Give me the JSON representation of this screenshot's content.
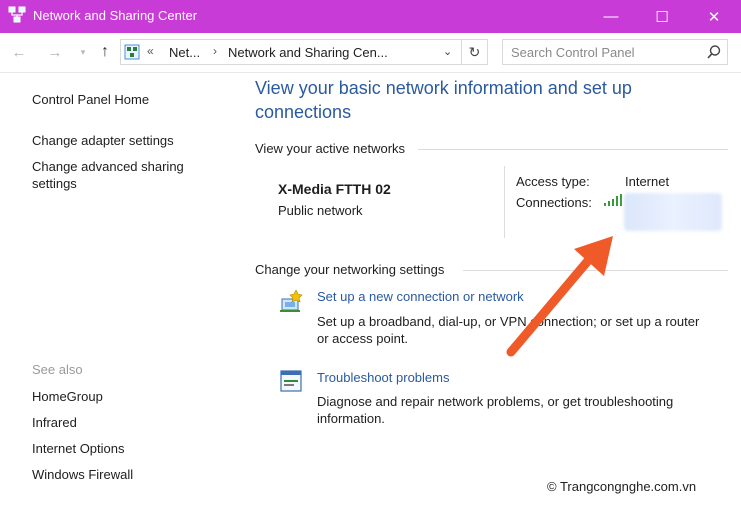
{
  "window": {
    "title": "Network and Sharing Center",
    "controls": {
      "minimize": "—",
      "maximize": "☐",
      "close": "✕"
    }
  },
  "address_bar": {
    "overflow": "«",
    "crumbs": [
      "Net...",
      "Network and Sharing Cen..."
    ],
    "search_placeholder": "Search Control Panel"
  },
  "left_pane": {
    "links": [
      "Control Panel Home",
      "Change adapter settings",
      "Change advanced sharing settings"
    ],
    "see_also_label": "See also",
    "see_also": [
      "HomeGroup",
      "Infrared",
      "Internet Options",
      "Windows Firewall"
    ]
  },
  "main": {
    "title": "View your basic network information and set up connections",
    "active_networks_label": "View your active networks",
    "network": {
      "name": "X-Media FTTH 02",
      "type": "Public network",
      "access_type_label": "Access type:",
      "access_type_value": "Internet",
      "connections_label": "Connections:"
    },
    "change_settings_label": "Change your networking settings",
    "tasks": [
      {
        "title": "Set up a new connection or network",
        "desc": "Set up a broadband, dial-up, or VPN connection; or set up a router or access point."
      },
      {
        "title": "Troubleshoot problems",
        "desc": "Diagnose and repair network problems, or get troubleshooting information."
      }
    ]
  },
  "annotation": {
    "arrow_color": "#f05a28"
  },
  "watermark": "© Trangcongnghe.com.vn",
  "colors": {
    "titlebar": "#c93bd6",
    "link": "#2a5aa0"
  },
  "icons": [
    "network-app-icon",
    "back-arrow-icon",
    "forward-arrow-icon",
    "up-arrow-icon",
    "location-icon",
    "refresh-icon",
    "search-icon",
    "signal-bars-icon",
    "new-connection-icon",
    "troubleshoot-icon"
  ]
}
